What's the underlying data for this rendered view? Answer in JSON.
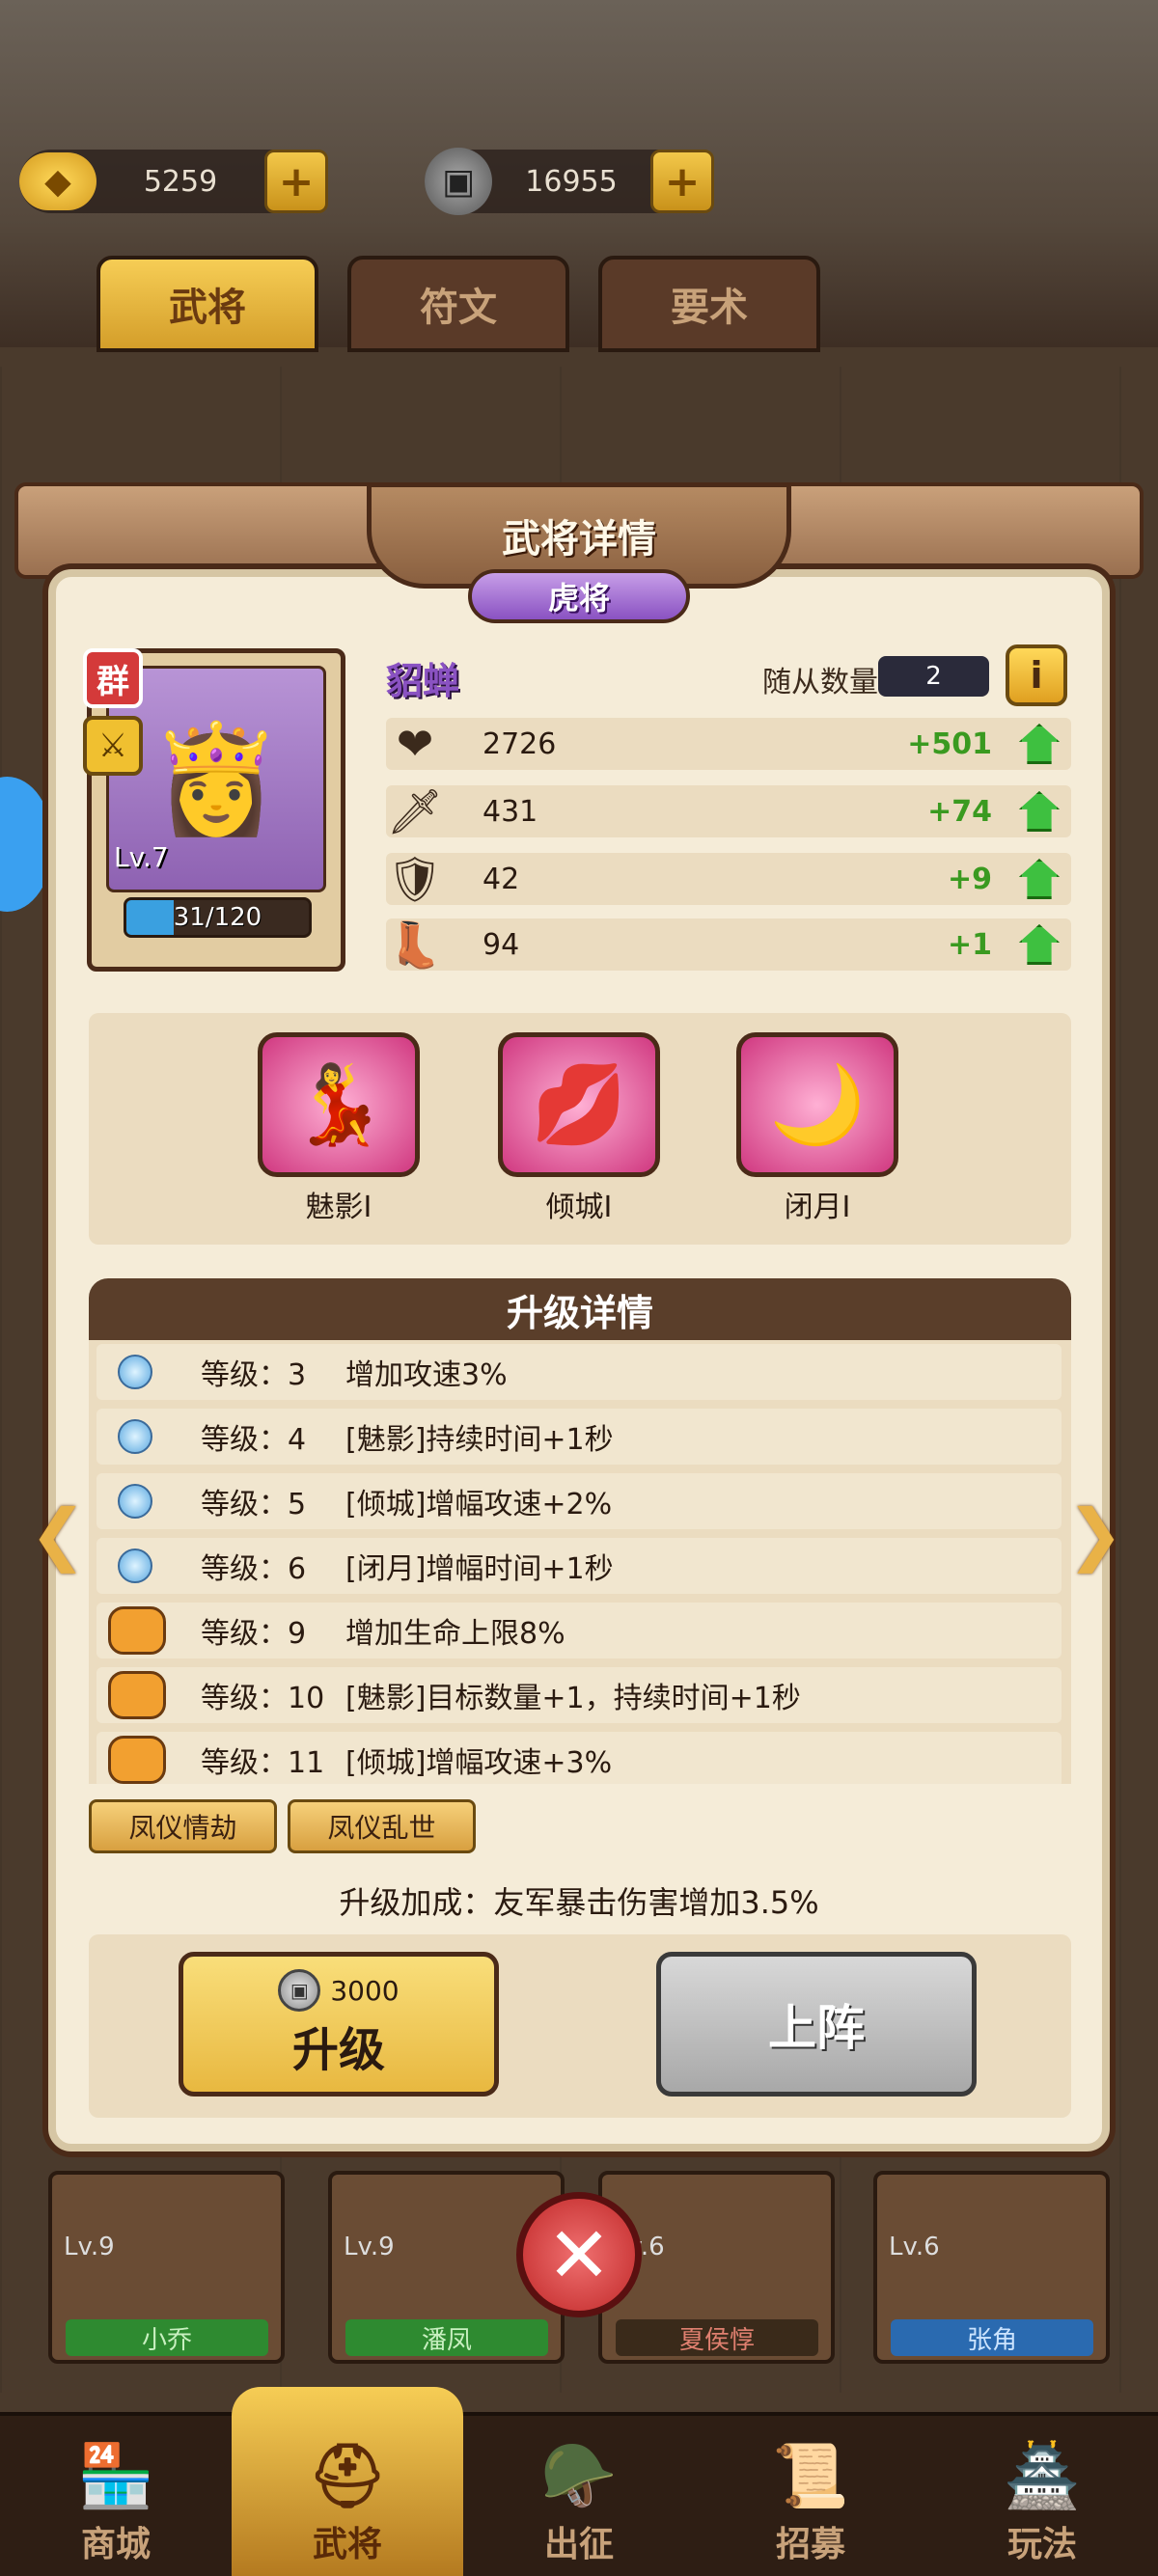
{
  "resources": {
    "gold": "5259",
    "coin": "16955"
  },
  "top_tabs": [
    "武将",
    "符文",
    "要术"
  ],
  "modal": {
    "title": "武将详情",
    "rank": "虎将"
  },
  "hero": {
    "name": "貂蝉",
    "faction": "群",
    "level": "Lv.7",
    "exp": "31/120",
    "exp_fraction": 0.26,
    "follower_label": "随从数量",
    "follower_count": "2",
    "info": "i"
  },
  "stats": [
    {
      "icon": "heart-icon",
      "value": "2726",
      "bonus": "+501"
    },
    {
      "icon": "sword-icon",
      "value": "431",
      "bonus": "+74"
    },
    {
      "icon": "shield-icon",
      "value": "42",
      "bonus": "+9"
    },
    {
      "icon": "boots-icon",
      "value": "94",
      "bonus": "+1"
    }
  ],
  "skills": [
    {
      "name": "魅影Ⅰ"
    },
    {
      "name": "倾城Ⅰ"
    },
    {
      "name": "闭月Ⅰ"
    }
  ],
  "upgrade": {
    "header": "升级详情",
    "rows": [
      {
        "level": "等级：3",
        "desc": "增加攻速3%",
        "icon": "orb"
      },
      {
        "level": "等级：4",
        "desc": "[魅影]持续时间+1秒",
        "icon": "orb"
      },
      {
        "level": "等级：5",
        "desc": "[倾城]增幅攻速+2%",
        "icon": "orb"
      },
      {
        "level": "等级：6",
        "desc": "[闭月]增幅时间+1秒",
        "icon": "orb"
      },
      {
        "level": "等级：9",
        "desc": "增加生命上限8%",
        "icon": "chest"
      },
      {
        "level": "等级：10",
        "desc": "[魅影]目标数量+1，持续时间+1秒",
        "icon": "chest"
      },
      {
        "level": "等级：11",
        "desc": "[倾城]增幅攻速+3%",
        "icon": "chest"
      }
    ]
  },
  "tags": [
    "凤仪情劫",
    "凤仪乱世"
  ],
  "bonus": "升级加成：友军暴击伤害增加3.5%",
  "actions": {
    "cost": "3000",
    "upgrade_label": "升级",
    "deploy_label": "上阵"
  },
  "bg_cards": [
    {
      "level": "Lv.9",
      "name": "小乔"
    },
    {
      "level": "Lv.9",
      "name": "潘凤"
    },
    {
      "level": "Lv.6",
      "name": "夏侯惇"
    },
    {
      "level": "Lv.6",
      "name": "张角"
    }
  ],
  "bottom_nav": [
    "商城",
    "武将",
    "出征",
    "招募",
    "玩法"
  ]
}
